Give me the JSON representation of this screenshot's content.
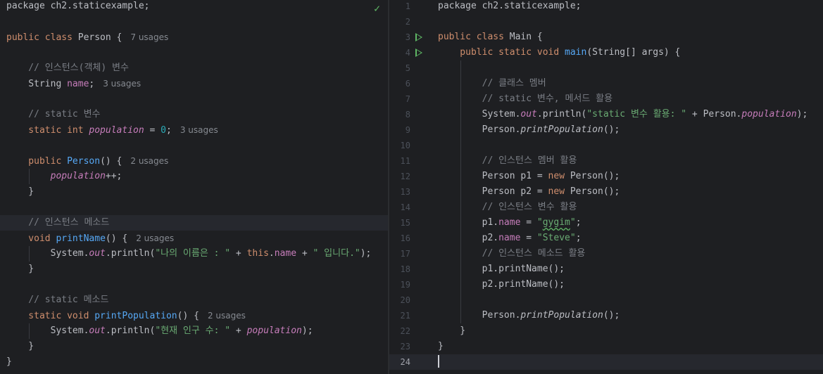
{
  "left_editor": {
    "lines": [
      {
        "parts": [
          {
            "t": "package ch2.staticexample;"
          }
        ]
      },
      {
        "parts": []
      },
      {
        "parts": [
          {
            "t": "public class ",
            "c": "kw"
          },
          {
            "t": "Person {"
          },
          {
            "t": "7 usages",
            "c": "hint"
          }
        ]
      },
      {
        "parts": []
      },
      {
        "parts": [
          {
            "t": "    // 인스턴스(객체) 변수",
            "c": "cmt"
          }
        ]
      },
      {
        "parts": [
          {
            "t": "    String "
          },
          {
            "t": "name",
            "c": "fld"
          },
          {
            "t": ";"
          },
          {
            "t": "3 usages",
            "c": "hint"
          }
        ]
      },
      {
        "parts": []
      },
      {
        "parts": [
          {
            "t": "    // static 변수",
            "c": "cmt"
          }
        ]
      },
      {
        "parts": [
          {
            "t": "    static int ",
            "c": "kw"
          },
          {
            "t": "population",
            "c": "sfld"
          },
          {
            "t": " = "
          },
          {
            "t": "0",
            "c": "num"
          },
          {
            "t": ";"
          },
          {
            "t": "3 usages",
            "c": "hint"
          }
        ]
      },
      {
        "parts": []
      },
      {
        "parts": [
          {
            "t": "    public ",
            "c": "kw"
          },
          {
            "t": "Person",
            "c": "fn"
          },
          {
            "t": "() {"
          },
          {
            "t": "2 usages",
            "c": "hint"
          }
        ]
      },
      {
        "parts": [
          {
            "t": "        "
          },
          {
            "t": "population",
            "c": "sfld"
          },
          {
            "t": "++;"
          }
        ]
      },
      {
        "parts": [
          {
            "t": "    }"
          }
        ]
      },
      {
        "parts": []
      },
      {
        "parts": [
          {
            "t": "    // 인스턴스 메소드",
            "c": "cmt"
          }
        ],
        "caret": true
      },
      {
        "parts": [
          {
            "t": "    void ",
            "c": "kw"
          },
          {
            "t": "printName",
            "c": "fn"
          },
          {
            "t": "() {"
          },
          {
            "t": "2 usages",
            "c": "hint"
          }
        ]
      },
      {
        "parts": [
          {
            "t": "        System."
          },
          {
            "t": "out",
            "c": "sfld"
          },
          {
            "t": ".println("
          },
          {
            "t": "\"나의 이름은 : \"",
            "c": "str"
          },
          {
            "t": " + "
          },
          {
            "t": "this",
            "c": "kw"
          },
          {
            "t": "."
          },
          {
            "t": "name",
            "c": "fld"
          },
          {
            "t": " + "
          },
          {
            "t": "\" 입니다.\"",
            "c": "str"
          },
          {
            "t": ");"
          }
        ]
      },
      {
        "parts": [
          {
            "t": "    }"
          }
        ]
      },
      {
        "parts": []
      },
      {
        "parts": [
          {
            "t": "    // static 메소드",
            "c": "cmt"
          }
        ]
      },
      {
        "parts": [
          {
            "t": "    static void ",
            "c": "kw"
          },
          {
            "t": "printPopulation",
            "c": "fn"
          },
          {
            "t": "() {"
          },
          {
            "t": "2 usages",
            "c": "hint"
          }
        ]
      },
      {
        "parts": [
          {
            "t": "        System."
          },
          {
            "t": "out",
            "c": "sfld"
          },
          {
            "t": ".println("
          },
          {
            "t": "\"현재 인구 수: \"",
            "c": "str"
          },
          {
            "t": " + "
          },
          {
            "t": "population",
            "c": "sfld"
          },
          {
            "t": ");"
          }
        ]
      },
      {
        "parts": [
          {
            "t": "    }"
          }
        ]
      },
      {
        "parts": [
          {
            "t": "}"
          }
        ]
      }
    ]
  },
  "right_editor": {
    "current_line": 24,
    "run_lines": [
      3,
      4
    ],
    "lines": [
      {
        "n": "1",
        "parts": [
          {
            "t": "package ch2.staticexample;"
          }
        ]
      },
      {
        "n": "2",
        "parts": []
      },
      {
        "n": "3",
        "parts": [
          {
            "t": "public class ",
            "c": "kw"
          },
          {
            "t": "Main {"
          }
        ]
      },
      {
        "n": "4",
        "parts": [
          {
            "t": "    public static void ",
            "c": "kw"
          },
          {
            "t": "main",
            "c": "fn"
          },
          {
            "t": "(String[] args) {"
          }
        ]
      },
      {
        "n": "5",
        "parts": []
      },
      {
        "n": "6",
        "parts": [
          {
            "t": "        // 클래스 멤버",
            "c": "cmt"
          }
        ]
      },
      {
        "n": "7",
        "parts": [
          {
            "t": "        // static 변수, 메서드 활용",
            "c": "cmt"
          }
        ]
      },
      {
        "n": "8",
        "parts": [
          {
            "t": "        System."
          },
          {
            "t": "out",
            "c": "sfld"
          },
          {
            "t": ".println("
          },
          {
            "t": "\"static 변수 활용: \"",
            "c": "str"
          },
          {
            "t": " + Person."
          },
          {
            "t": "population",
            "c": "sfld"
          },
          {
            "t": ");"
          }
        ]
      },
      {
        "n": "9",
        "parts": [
          {
            "t": "        Person."
          },
          {
            "t": "printPopulation",
            "c": "sfn"
          },
          {
            "t": "();"
          }
        ]
      },
      {
        "n": "10",
        "parts": []
      },
      {
        "n": "11",
        "parts": [
          {
            "t": "        // 인스턴스 멤버 활용",
            "c": "cmt"
          }
        ]
      },
      {
        "n": "12",
        "parts": [
          {
            "t": "        Person p1 = "
          },
          {
            "t": "new ",
            "c": "kw"
          },
          {
            "t": "Person();"
          }
        ]
      },
      {
        "n": "13",
        "parts": [
          {
            "t": "        Person p2 = "
          },
          {
            "t": "new ",
            "c": "kw"
          },
          {
            "t": "Person();"
          }
        ]
      },
      {
        "n": "14",
        "parts": [
          {
            "t": "        // 인스턴스 변수 활용",
            "c": "cmt"
          }
        ]
      },
      {
        "n": "15",
        "parts": [
          {
            "t": "        p1."
          },
          {
            "t": "name",
            "c": "fld"
          },
          {
            "t": " = "
          },
          {
            "t": "\"",
            "c": "str"
          },
          {
            "t": "gygim",
            "c": "str typo"
          },
          {
            "t": "\"",
            "c": "str"
          },
          {
            "t": ";"
          }
        ]
      },
      {
        "n": "16",
        "parts": [
          {
            "t": "        p2."
          },
          {
            "t": "name",
            "c": "fld"
          },
          {
            "t": " = "
          },
          {
            "t": "\"Steve\"",
            "c": "str"
          },
          {
            "t": ";"
          }
        ]
      },
      {
        "n": "17",
        "parts": [
          {
            "t": "        // 인스턴스 메소드 활용",
            "c": "cmt"
          }
        ]
      },
      {
        "n": "18",
        "parts": [
          {
            "t": "        p1.printName();"
          }
        ]
      },
      {
        "n": "19",
        "parts": [
          {
            "t": "        p2.printName();"
          }
        ]
      },
      {
        "n": "20",
        "parts": []
      },
      {
        "n": "21",
        "parts": [
          {
            "t": "        Person."
          },
          {
            "t": "printPopulation",
            "c": "sfn"
          },
          {
            "t": "();"
          }
        ]
      },
      {
        "n": "22",
        "parts": [
          {
            "t": "    }"
          }
        ]
      },
      {
        "n": "23",
        "parts": [
          {
            "t": "}"
          }
        ]
      },
      {
        "n": "24",
        "parts": []
      }
    ]
  },
  "icons": {
    "inspection_ok": "check-icon",
    "run": "run-icon"
  },
  "colors": {
    "background": "#1e1f22",
    "keyword": "#cf8e6d",
    "string": "#6aab73",
    "number": "#2aacb8",
    "field": "#c77dbb",
    "function": "#56a8f5",
    "comment": "#7a7e85"
  }
}
